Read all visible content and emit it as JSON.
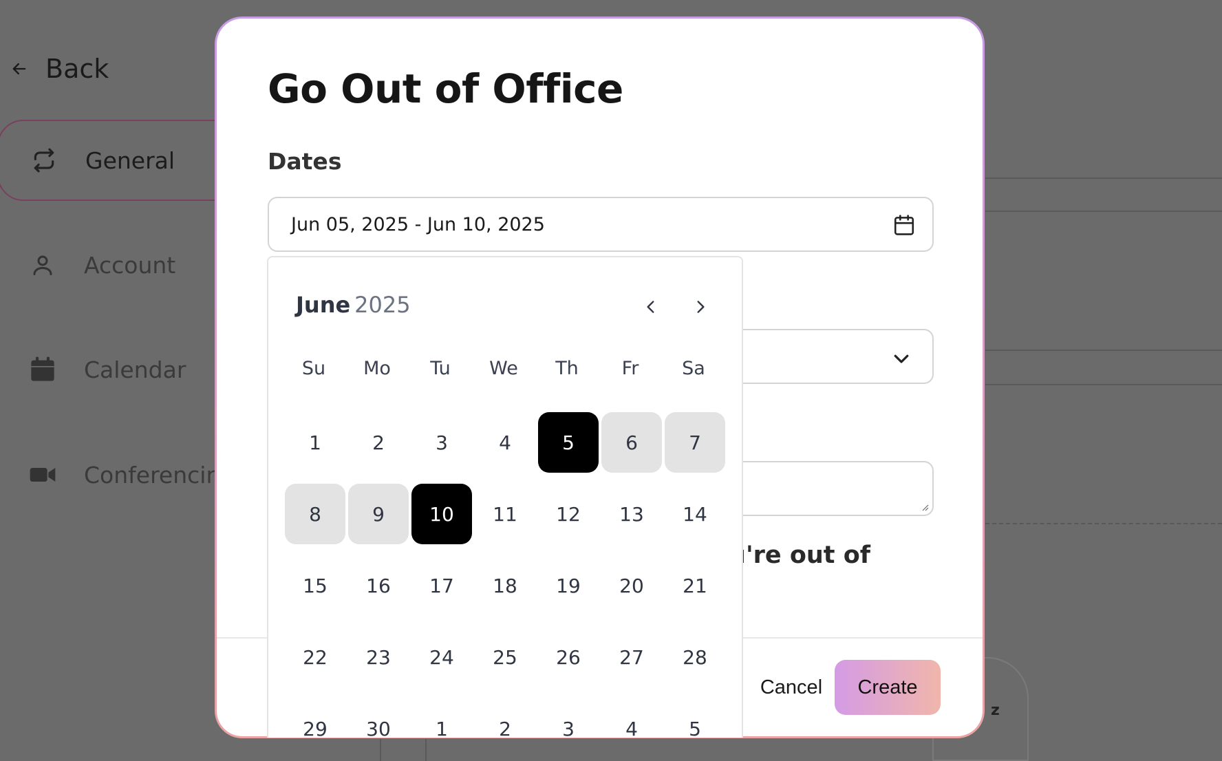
{
  "background": {
    "back_label": "Back",
    "nav": [
      {
        "label": "General",
        "icon": "repeat-icon"
      },
      {
        "label": "Account",
        "icon": "user-icon"
      },
      {
        "label": "Calendar",
        "icon": "calendar-icon"
      },
      {
        "label": "Conferencing",
        "icon": "video-icon"
      }
    ]
  },
  "modal": {
    "title": "Go Out of Office",
    "dates_label": "Dates",
    "date_range_value": "Jun 05, 2025 - Jun 10, 2025",
    "partial_toggle_text": "ou're out of",
    "cancel_label": "Cancel",
    "create_label": "Create"
  },
  "calendar": {
    "month": "June",
    "year": "2025",
    "weekdays": [
      "Su",
      "Mo",
      "Tu",
      "We",
      "Th",
      "Fr",
      "Sa"
    ],
    "days": [
      {
        "n": "1",
        "s": ""
      },
      {
        "n": "2",
        "s": ""
      },
      {
        "n": "3",
        "s": ""
      },
      {
        "n": "4",
        "s": ""
      },
      {
        "n": "5",
        "s": "selected"
      },
      {
        "n": "6",
        "s": "range"
      },
      {
        "n": "7",
        "s": "range"
      },
      {
        "n": "8",
        "s": "range"
      },
      {
        "n": "9",
        "s": "range"
      },
      {
        "n": "10",
        "s": "selected"
      },
      {
        "n": "11",
        "s": ""
      },
      {
        "n": "12",
        "s": ""
      },
      {
        "n": "13",
        "s": ""
      },
      {
        "n": "14",
        "s": ""
      },
      {
        "n": "15",
        "s": ""
      },
      {
        "n": "16",
        "s": ""
      },
      {
        "n": "17",
        "s": ""
      },
      {
        "n": "18",
        "s": ""
      },
      {
        "n": "19",
        "s": ""
      },
      {
        "n": "20",
        "s": ""
      },
      {
        "n": "21",
        "s": ""
      },
      {
        "n": "22",
        "s": ""
      },
      {
        "n": "23",
        "s": ""
      },
      {
        "n": "24",
        "s": ""
      },
      {
        "n": "25",
        "s": ""
      },
      {
        "n": "26",
        "s": ""
      },
      {
        "n": "27",
        "s": ""
      },
      {
        "n": "28",
        "s": ""
      },
      {
        "n": "29",
        "s": ""
      },
      {
        "n": "30",
        "s": ""
      },
      {
        "n": "1",
        "s": ""
      },
      {
        "n": "2",
        "s": ""
      },
      {
        "n": "3",
        "s": ""
      },
      {
        "n": "4",
        "s": ""
      },
      {
        "n": "5",
        "s": ""
      }
    ]
  },
  "colors": {
    "overlay": "#6b6b6b",
    "selected_day": "#000000",
    "range_day": "#e3e3e3",
    "create_gradient_start": "#d49be5",
    "create_gradient_end": "#f0b6ab"
  }
}
